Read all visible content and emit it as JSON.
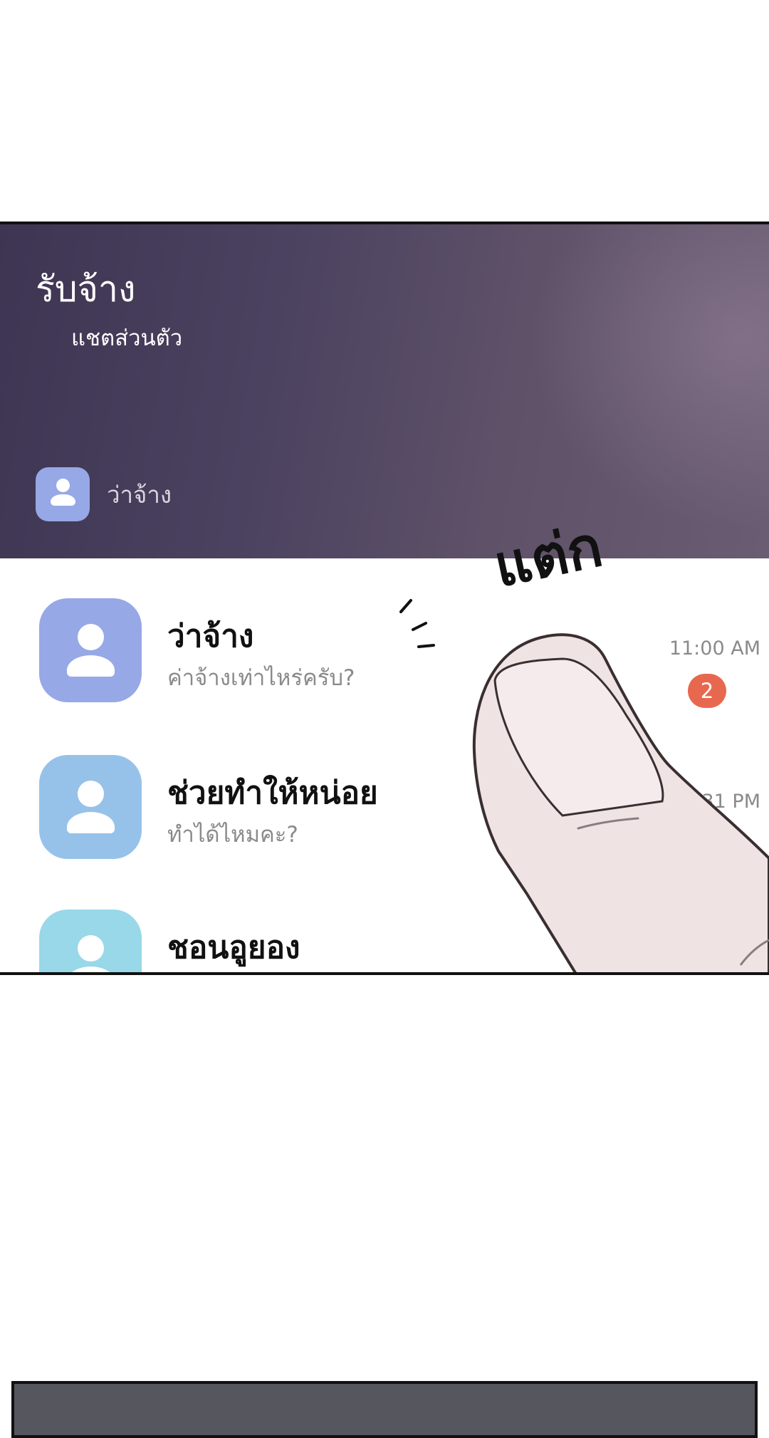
{
  "header": {
    "title": "รับจ้าง",
    "subtitle": "แชตส่วนตัว",
    "contact_label": "ว่าจ้าง"
  },
  "sound_effect": "แต่ก",
  "chats": [
    {
      "name": "ว่าจ้าง",
      "preview": "ค่าจ้างเท่าไหร่ครับ?",
      "time": "11:00 AM",
      "unread": "2",
      "avatar_color": "#97a8e6"
    },
    {
      "name": "ช่วยทำให้หน่อย",
      "preview": "ทำได้ไหมคะ?",
      "time": "4:31 PM",
      "avatar_color": "#96c2ea"
    },
    {
      "name": "ชอนอูยอง",
      "avatar_color": "#98d8e8"
    }
  ],
  "colors": {
    "header_gradient_start": "#3d3552",
    "header_gradient_end": "#6a5c72",
    "badge": "#e8684f",
    "finger_skin": "#efe3e4"
  }
}
